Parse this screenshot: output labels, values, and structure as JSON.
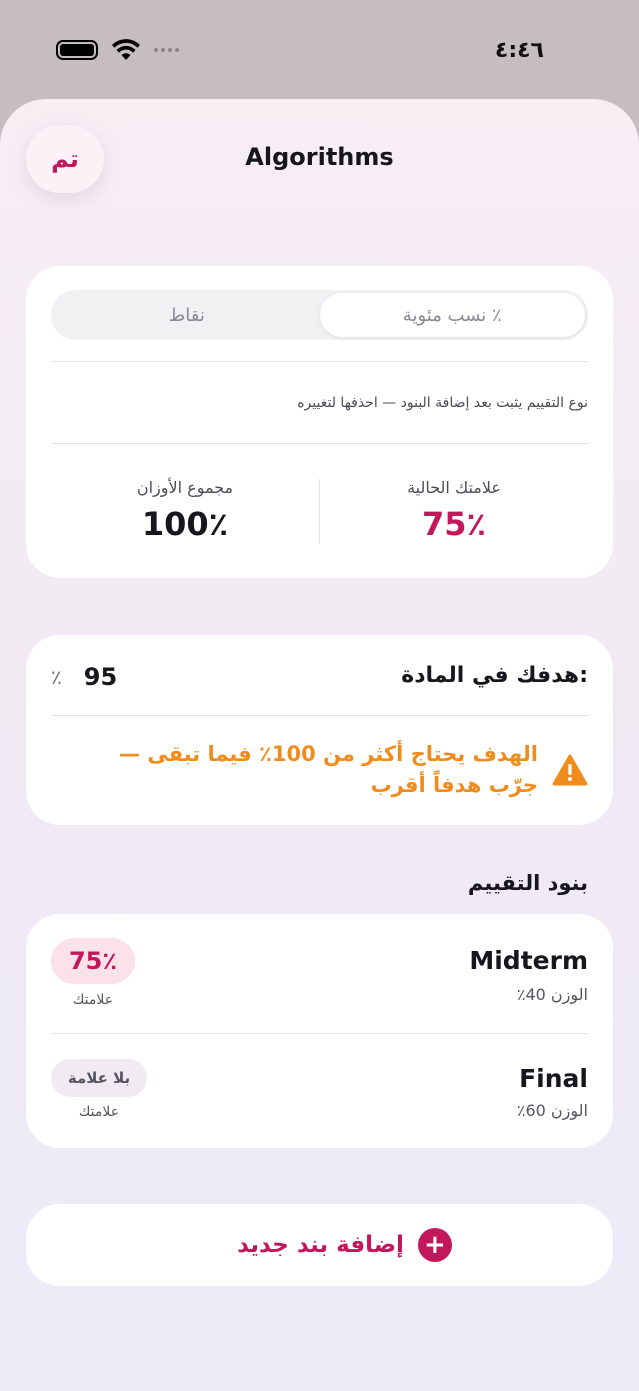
{
  "status_bar": {
    "time": "٤:٤٦"
  },
  "header": {
    "done_label": "تم",
    "title": "Algorithms"
  },
  "grading_type": {
    "options": [
      "نسب مئوية ٪",
      "نقاط"
    ],
    "selected": "نسب مئوية ٪",
    "note": "نوع التقييم يثبت بعد إضافة البنود — احذفها لتغييره",
    "current_mark_label": "علامتك الحالية",
    "current_mark_value": "75٪",
    "weights_total_label": "مجموع الأوزان",
    "weights_total_value": "100٪"
  },
  "target": {
    "label": "هدفك في المادة:",
    "value": "95",
    "unit": "٪",
    "warning": "الهدف يحتاج أكثر من 100٪ فيما تبقى — جرّب هدفاً أقرب",
    "warning_icon": "warning-triangle-icon"
  },
  "items_section": {
    "title": "بنود التقييم",
    "items": [
      {
        "name": "Midterm",
        "weight": "الوزن 40٪",
        "mark": "75٪",
        "mark_caption": "علامتك"
      },
      {
        "name": "Final",
        "weight": "الوزن 60٪",
        "mark": "بلا علامة",
        "mark_caption": "علامتك"
      }
    ]
  },
  "add_item": {
    "label": "إضافة بند جديد",
    "icon": "plus-icon"
  },
  "colors": {
    "accent": "#c2185b",
    "warning": "#f08c1c",
    "badge_score_bg": "#fbe1ea"
  }
}
